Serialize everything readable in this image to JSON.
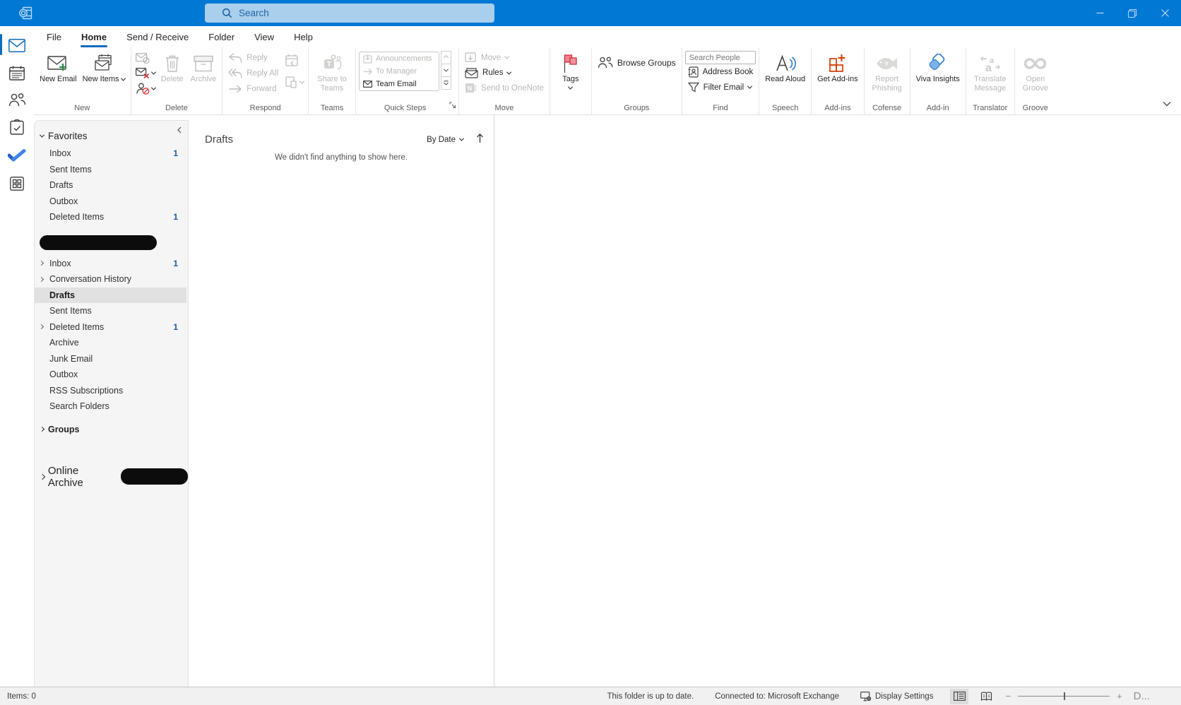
{
  "titlebar": {
    "search_placeholder": "Search"
  },
  "window_controls": {
    "minimize": "minimize",
    "restore": "restore",
    "close": "close"
  },
  "menubar": {
    "tabs": [
      "File",
      "Home",
      "Send / Receive",
      "Folder",
      "View",
      "Help"
    ],
    "active_tab": "Home"
  },
  "ribbon": {
    "new_email": "New Email",
    "new_items": "New Items",
    "delete": "Delete",
    "archive": "Archive",
    "reply": "Reply",
    "reply_all": "Reply All",
    "forward": "Forward",
    "share_to_teams": "Share to Teams",
    "quick_steps": {
      "announcements": "Announcements",
      "to_manager": "To Manager",
      "team_email": "Team Email"
    },
    "move": "Move",
    "rules": "Rules",
    "send_to_onenote": "Send to OneNote",
    "tags": "Tags",
    "browse_groups": "Browse Groups",
    "search_people_placeholder": "Search People",
    "address_book": "Address Book",
    "filter_email": "Filter Email",
    "read_aloud": "Read Aloud",
    "get_addins": "Get Add-ins",
    "report_phishing": "Report Phishing",
    "viva_insights": "Viva Insights",
    "translate_message": "Translate Message",
    "open_groove": "Open Groove",
    "group_labels": {
      "new": "New",
      "delete": "Delete",
      "respond": "Respond",
      "teams": "Teams",
      "quick_steps": "Quick Steps",
      "move": "Move",
      "groups": "Groups",
      "find": "Find",
      "speech": "Speech",
      "addins": "Add-ins",
      "cofense": "Cofense",
      "addin": "Add-in",
      "translator": "Translator",
      "groove": "Groove"
    }
  },
  "folders": {
    "favorites": {
      "label": "Favorites",
      "items": [
        {
          "label": "Inbox",
          "count": "1"
        },
        {
          "label": "Sent Items",
          "count": ""
        },
        {
          "label": "Drafts",
          "count": ""
        },
        {
          "label": "Outbox",
          "count": ""
        },
        {
          "label": "Deleted Items",
          "count": "1"
        }
      ]
    },
    "account": {
      "items": [
        {
          "label": "Inbox",
          "count": "1"
        },
        {
          "label": "Conversation History",
          "count": ""
        },
        {
          "label": "Drafts",
          "count": ""
        },
        {
          "label": "Sent Items",
          "count": ""
        },
        {
          "label": "Deleted Items",
          "count": "1"
        },
        {
          "label": "Archive",
          "count": ""
        },
        {
          "label": "Junk Email",
          "count": ""
        },
        {
          "label": "Outbox",
          "count": ""
        },
        {
          "label": "RSS Subscriptions",
          "count": ""
        },
        {
          "label": "Search Folders",
          "count": ""
        }
      ],
      "selected": "Drafts"
    },
    "groups_label": "Groups",
    "online_archive_label": "Online Archive"
  },
  "list_pane": {
    "title": "Drafts",
    "sort_label": "By Date",
    "empty_message": "We didn't find anything to show here."
  },
  "statusbar": {
    "items_count": "Items: 0",
    "folder_status": "This folder is up to date.",
    "connection": "Connected to: Microsoft Exchange",
    "display_settings": "Display Settings",
    "overflow_text": "D..."
  },
  "colors": {
    "titlebar_blue": "#0078d4",
    "accent_blue": "#0f6cbd",
    "unread_count_blue": "#1f56a3",
    "tags_flag_red": "#e8526a",
    "addins_orange": "#d83b01",
    "insights_blue": "#2f7ad4",
    "disabled_gray": "#b9b7b5"
  }
}
